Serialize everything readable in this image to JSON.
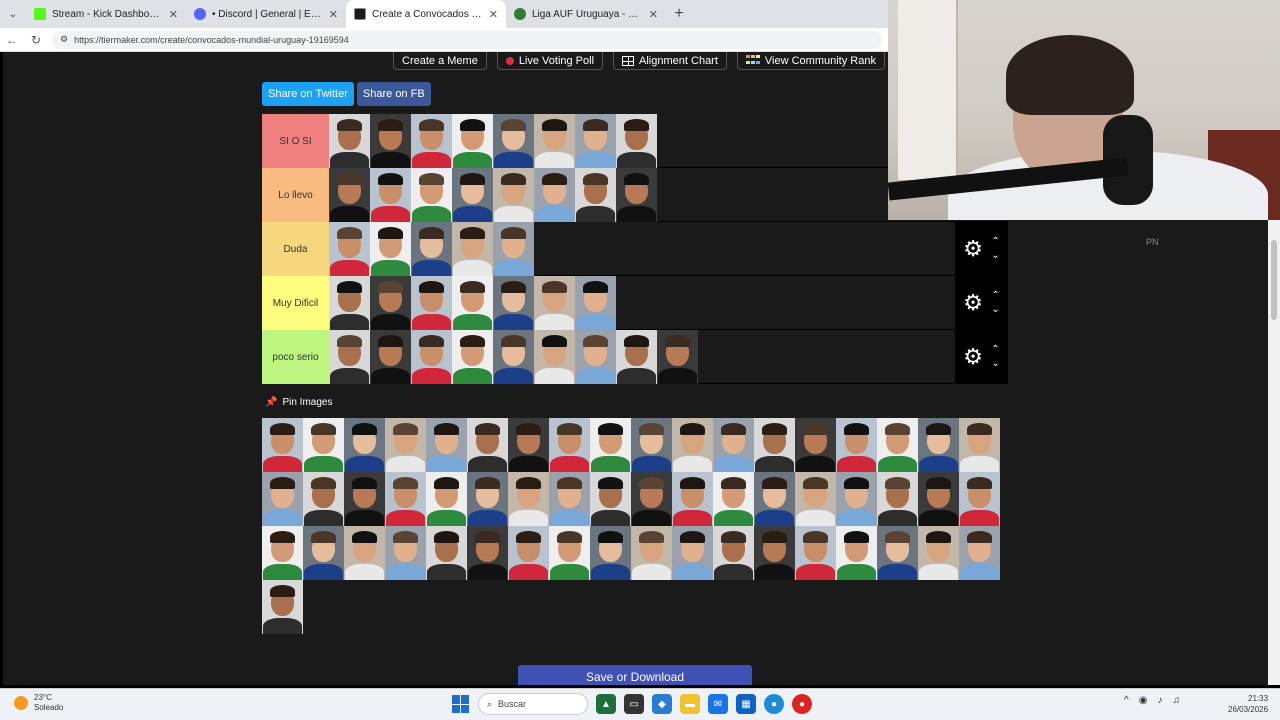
{
  "browser": {
    "tabs": [
      {
        "title": "Stream - Kick Dashboard",
        "color": "#53fc18",
        "active": false
      },
      {
        "title": "• Discord | General | El ...",
        "color": "#5865f2",
        "active": false
      },
      {
        "title": "Create a Convocados Mundial Uru",
        "color": "#1a1a1a",
        "active": true
      },
      {
        "title": "Liga AUF Uruguaya - POSICIONES",
        "color": "#2e7d32",
        "active": false
      }
    ],
    "url": "https://tiermaker.com/create/convocados-mundial-uruguay-19169594"
  },
  "top_buttons": {
    "meme": "Create a Meme",
    "poll": "Live Voting Poll",
    "alignment": "Alignment Chart",
    "community": "View Community Rank"
  },
  "share": {
    "twitter": "Share on Twitter",
    "fb": "Share on FB"
  },
  "tiers": [
    {
      "label": "SI O SI",
      "color": "#f08080",
      "count": 8
    },
    {
      "label": "Lo llevo",
      "color": "#f9bb7f",
      "count": 8
    },
    {
      "label": "Duda",
      "color": "#f6d77e",
      "count": 5
    },
    {
      "label": "Muy Dificil",
      "color": "#fdfd7e",
      "count": 7
    },
    {
      "label": "poco serio",
      "color": "#bdf57e",
      "count": 9
    }
  ],
  "pin_label": "Pin Images",
  "pool_count": 55,
  "save_label": "Save or Download",
  "pn_label": "PN",
  "taskbar": {
    "temp": "23°C",
    "weather": "Soleado",
    "search": "Buscar",
    "time": "21:33",
    "date": "26/03/2026"
  }
}
